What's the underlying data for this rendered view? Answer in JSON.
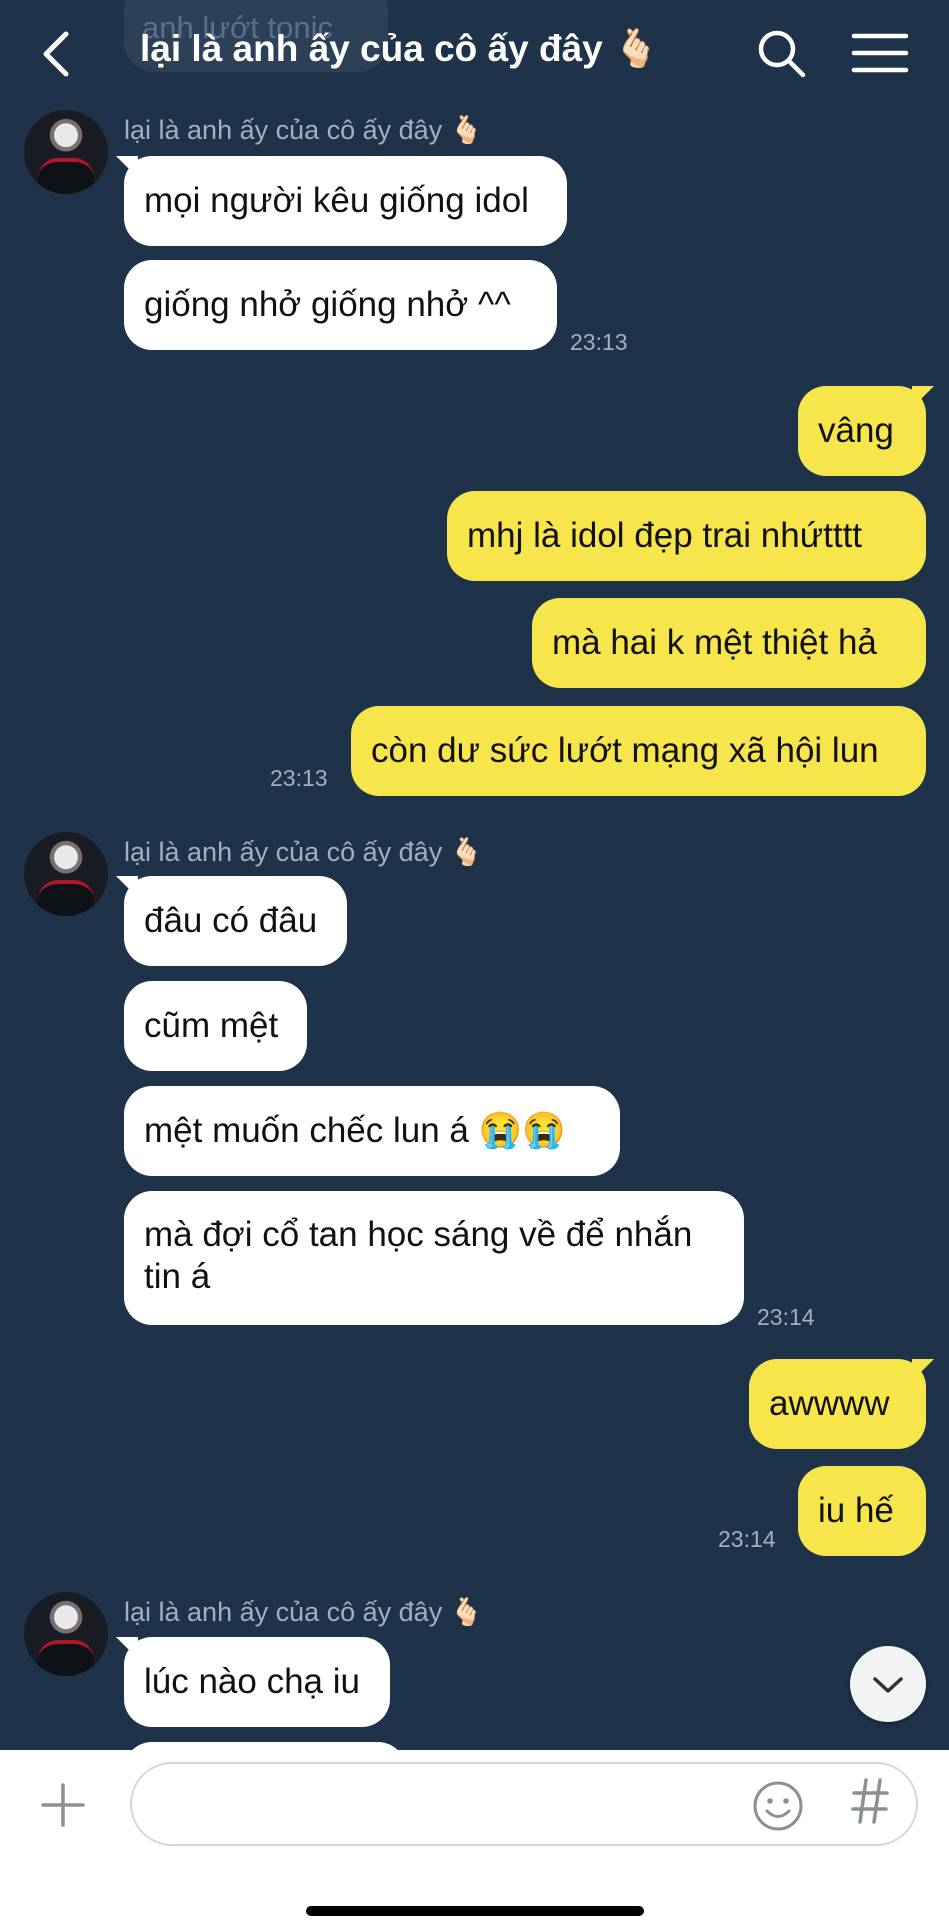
{
  "header": {
    "title": "lại là anh ấy của cô ấy đây 🫰🏻",
    "ghost_text": "anh lướt tonic"
  },
  "sender_name": "lại là anh ấy của cô ấy đây 🫰🏻",
  "messages": {
    "m1": "mọi người kêu giống idol",
    "m2": "giống nhở giống nhở ^^",
    "t1": "23:13",
    "o1": "vâng",
    "o2": "mhj là idol đẹp trai nhứtttt",
    "o3": "mà hai k mệt thiệt hả",
    "o4": "còn dư sức lướt mạng xã hội lun",
    "t2": "23:13",
    "m3": "đâu có đâu",
    "m4": "cũm mệt",
    "m5": "mệt muốn chếc lun á 😭😭",
    "m6a": "mà đợi cổ tan học sáng về để nhắn",
    "m6b": "tin á",
    "t3": "23:14",
    "o5": "awwww",
    "o6": "iu hế",
    "t4": "23:14",
    "m7": "lúc nào chạ iu"
  },
  "input": {
    "placeholder": ""
  },
  "icons": {
    "back": "chevron-left-icon",
    "search": "search-icon",
    "menu": "hamburger-menu-icon",
    "scroll": "chevron-down-icon",
    "plus": "plus-icon",
    "emoji": "emoji-icon",
    "hashtag": "hashtag-icon"
  },
  "colors": {
    "background": "#1e3349",
    "incoming_bubble": "#ffffff",
    "outgoing_bubble": "#f6e54b"
  }
}
